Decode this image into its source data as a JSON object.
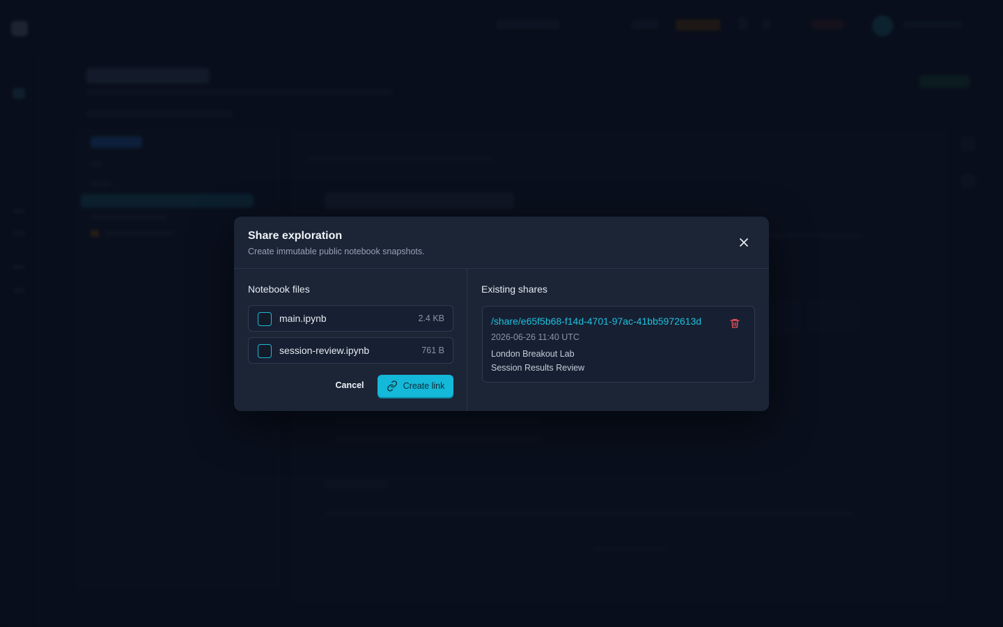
{
  "modal": {
    "title": "Share exploration",
    "subtitle": "Create immutable public notebook snapshots.",
    "close_icon": "close-icon"
  },
  "files_section": {
    "title": "Notebook files",
    "files": [
      {
        "name": "main.ipynb",
        "size": "2.4 KB",
        "checked": false
      },
      {
        "name": "session-review.ipynb",
        "size": "761 B",
        "checked": false
      }
    ],
    "cancel_label": "Cancel",
    "create_label": "Create link",
    "create_icon": "link-icon"
  },
  "shares_section": {
    "title": "Existing shares",
    "shares": [
      {
        "url": "/share/e65f5b68-f14d-4701-97ac-41bb5972613d",
        "date": "2026-06-26 11:40 UTC",
        "lines": [
          "London Breakout Lab",
          "Session Results Review"
        ],
        "delete_icon": "trash-icon"
      }
    ]
  },
  "colors": {
    "accent": "#14b8d8",
    "link": "#1ec0de",
    "danger": "#f0525e",
    "modal_bg": "#1b2536"
  }
}
